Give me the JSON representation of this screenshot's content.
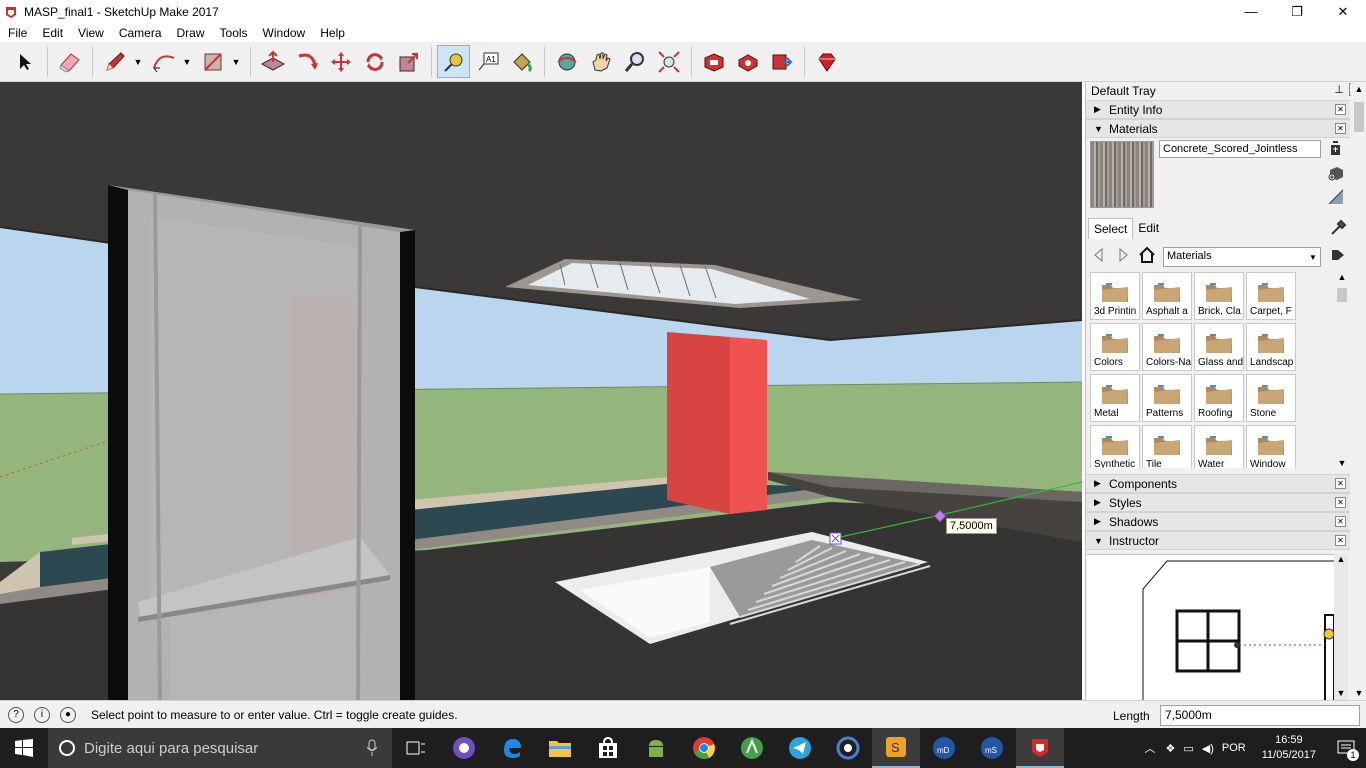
{
  "window": {
    "title": "MASP_final1 - SketchUp Make 2017",
    "minimize": "—",
    "maximize": "❐",
    "close": "✕"
  },
  "menu": [
    "File",
    "Edit",
    "View",
    "Camera",
    "Draw",
    "Tools",
    "Window",
    "Help"
  ],
  "toolbar": {
    "tools": [
      "select-icon",
      "eraser-icon",
      "pencil-icon",
      "arc-icon",
      "rectangle-icon",
      "push-pull-icon",
      "follow-me-icon",
      "move-icon",
      "rotate-icon",
      "scale-icon",
      "tape-measure-icon",
      "text-icon",
      "paint-bucket-icon",
      "orbit-icon",
      "pan-icon",
      "zoom-icon",
      "zoom-extents-icon",
      "warehouse-icon",
      "extension-warehouse-icon",
      "share-model-icon",
      "ruby-icon"
    ],
    "active_tool": "tape-measure-icon"
  },
  "viewport": {
    "measure_label": "7,5000m"
  },
  "tray": {
    "title": "Default Tray",
    "pin": "📌",
    "close": "✕",
    "panels_top": [
      {
        "label": "Entity Info",
        "expanded": false
      },
      {
        "label": "Materials",
        "expanded": true
      }
    ],
    "materials": {
      "current_name": "Concrete_Scored_Jointless",
      "tabs": [
        "Select",
        "Edit"
      ],
      "library": "Materials",
      "items": [
        "3d Printin",
        "Asphalt a",
        "Brick, Cla",
        "Carpet, F",
        "Colors",
        "Colors-Na",
        "Glass and",
        "Landscap",
        "Metal",
        "Patterns",
        "Roofing",
        "Stone",
        "Synthetic",
        "Tile",
        "Water",
        "Window"
      ]
    },
    "panels_bottom": [
      {
        "label": "Components",
        "expanded": false
      },
      {
        "label": "Styles",
        "expanded": false
      },
      {
        "label": "Shadows",
        "expanded": false
      },
      {
        "label": "Instructor",
        "expanded": true
      }
    ]
  },
  "status": {
    "message": "Select point to measure to or enter value.  Ctrl = toggle create guides.",
    "vcb_label": "Length",
    "vcb_value": "7,5000m"
  },
  "taskbar": {
    "search_placeholder": "Digite aqui para pesquisar",
    "language": "POR",
    "time": "16:59",
    "date": "11/05/2017",
    "notifications": "1"
  },
  "colors": {
    "accent": "#cde5f7",
    "red_pillar": "#e8504e",
    "ground": "#94b57c",
    "sky": "#b9d6ee",
    "slab": "#3d3b39"
  }
}
